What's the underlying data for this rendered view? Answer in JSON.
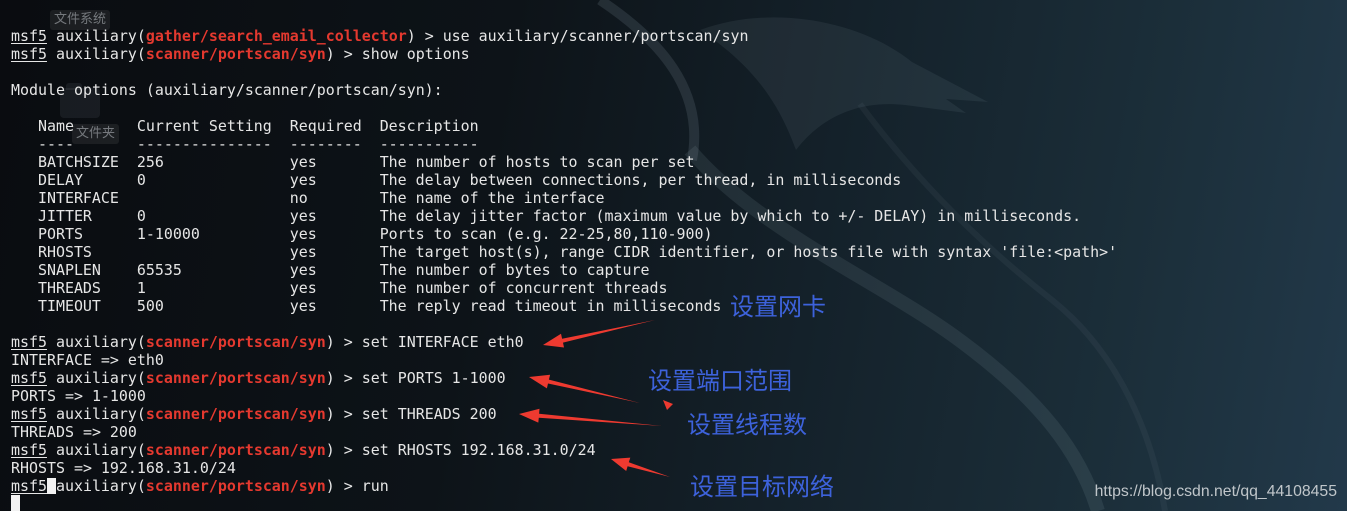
{
  "desktop_icons": [
    {
      "label": "文件系统"
    },
    {
      "label": "文件夹",
      "icon": "folder-icon"
    }
  ],
  "terminal": {
    "history": [
      {
        "user": "msf5",
        "context": "auxiliary(",
        "module": "gather/search_email_collector",
        "close": ") >",
        "command": "use auxiliary/scanner/portscan/syn"
      },
      {
        "user": "msf5",
        "context": "auxiliary(",
        "module": "scanner/portscan/syn",
        "close": ") >",
        "command": "show options"
      }
    ],
    "module_options": {
      "title": "Module options (auxiliary/scanner/portscan/syn):",
      "columns": [
        "Name",
        "Current Setting",
        "Required",
        "Description"
      ],
      "underlines": [
        "----",
        "---------------",
        "--------",
        "-----------"
      ],
      "rows": [
        {
          "name": "BATCHSIZE",
          "current": "256",
          "required": "yes",
          "description": "The number of hosts to scan per set"
        },
        {
          "name": "DELAY",
          "current": "0",
          "required": "yes",
          "description": "The delay between connections, per thread, in milliseconds"
        },
        {
          "name": "INTERFACE",
          "required": "no",
          "description": "The name of the interface"
        },
        {
          "name": "JITTER",
          "current": "0",
          "required": "yes",
          "description": "The delay jitter factor (maximum value by which to +/- DELAY) in milliseconds."
        },
        {
          "name": "PORTS",
          "current": "1-10000",
          "required": "yes",
          "description": "Ports to scan (e.g. 22-25,80,110-900)"
        },
        {
          "name": "RHOSTS",
          "required": "yes",
          "description": "The target host(s), range CIDR identifier, or hosts file with syntax 'file:<path>'"
        },
        {
          "name": "SNAPLEN",
          "current": "65535",
          "required": "yes",
          "description": "The number of bytes to capture"
        },
        {
          "name": "THREADS",
          "current": "1",
          "required": "yes",
          "description": "The number of concurrent threads"
        },
        {
          "name": "TIMEOUT",
          "current": "500",
          "required": "yes",
          "description": "The reply read timeout in milliseconds"
        }
      ]
    },
    "set_commands": [
      {
        "user": "msf5",
        "context": "auxiliary(",
        "module": "scanner/portscan/syn",
        "close": ") >",
        "command": "set INTERFACE eth0",
        "result": "INTERFACE => eth0"
      },
      {
        "user": "msf5",
        "context": "auxiliary(",
        "module": "scanner/portscan/syn",
        "close": ") >",
        "command": "set PORTS 1-1000",
        "result": "PORTS => 1-1000"
      },
      {
        "user": "msf5",
        "context": "auxiliary(",
        "module": "scanner/portscan/syn",
        "close": ") >",
        "command": "set THREADS 200",
        "result": "THREADS => 200"
      },
      {
        "user": "msf5",
        "context": "auxiliary(",
        "module": "scanner/portscan/syn",
        "close": ") >",
        "command": "set RHOSTS 192.168.31.0/24",
        "result": "RHOSTS => 192.168.31.0/24"
      }
    ],
    "run_command": {
      "user": "msf5",
      "context": "auxiliary(",
      "module": "scanner/portscan/syn",
      "close": ") >",
      "command": "run"
    }
  },
  "annotations": [
    {
      "label": "设置网卡"
    },
    {
      "label": "设置端口范围"
    },
    {
      "label": "设置线程数"
    },
    {
      "label": "设置目标网络"
    }
  ],
  "watermark": "https://blog.csdn.net/qq_44108455",
  "colors": {
    "text": "#e6e6e6",
    "module": "#e5392f",
    "annotation": "#3d62db",
    "arrow": "#ee3a30",
    "watermark": "#c0c6ca",
    "cursor": "#f2f2f2"
  }
}
